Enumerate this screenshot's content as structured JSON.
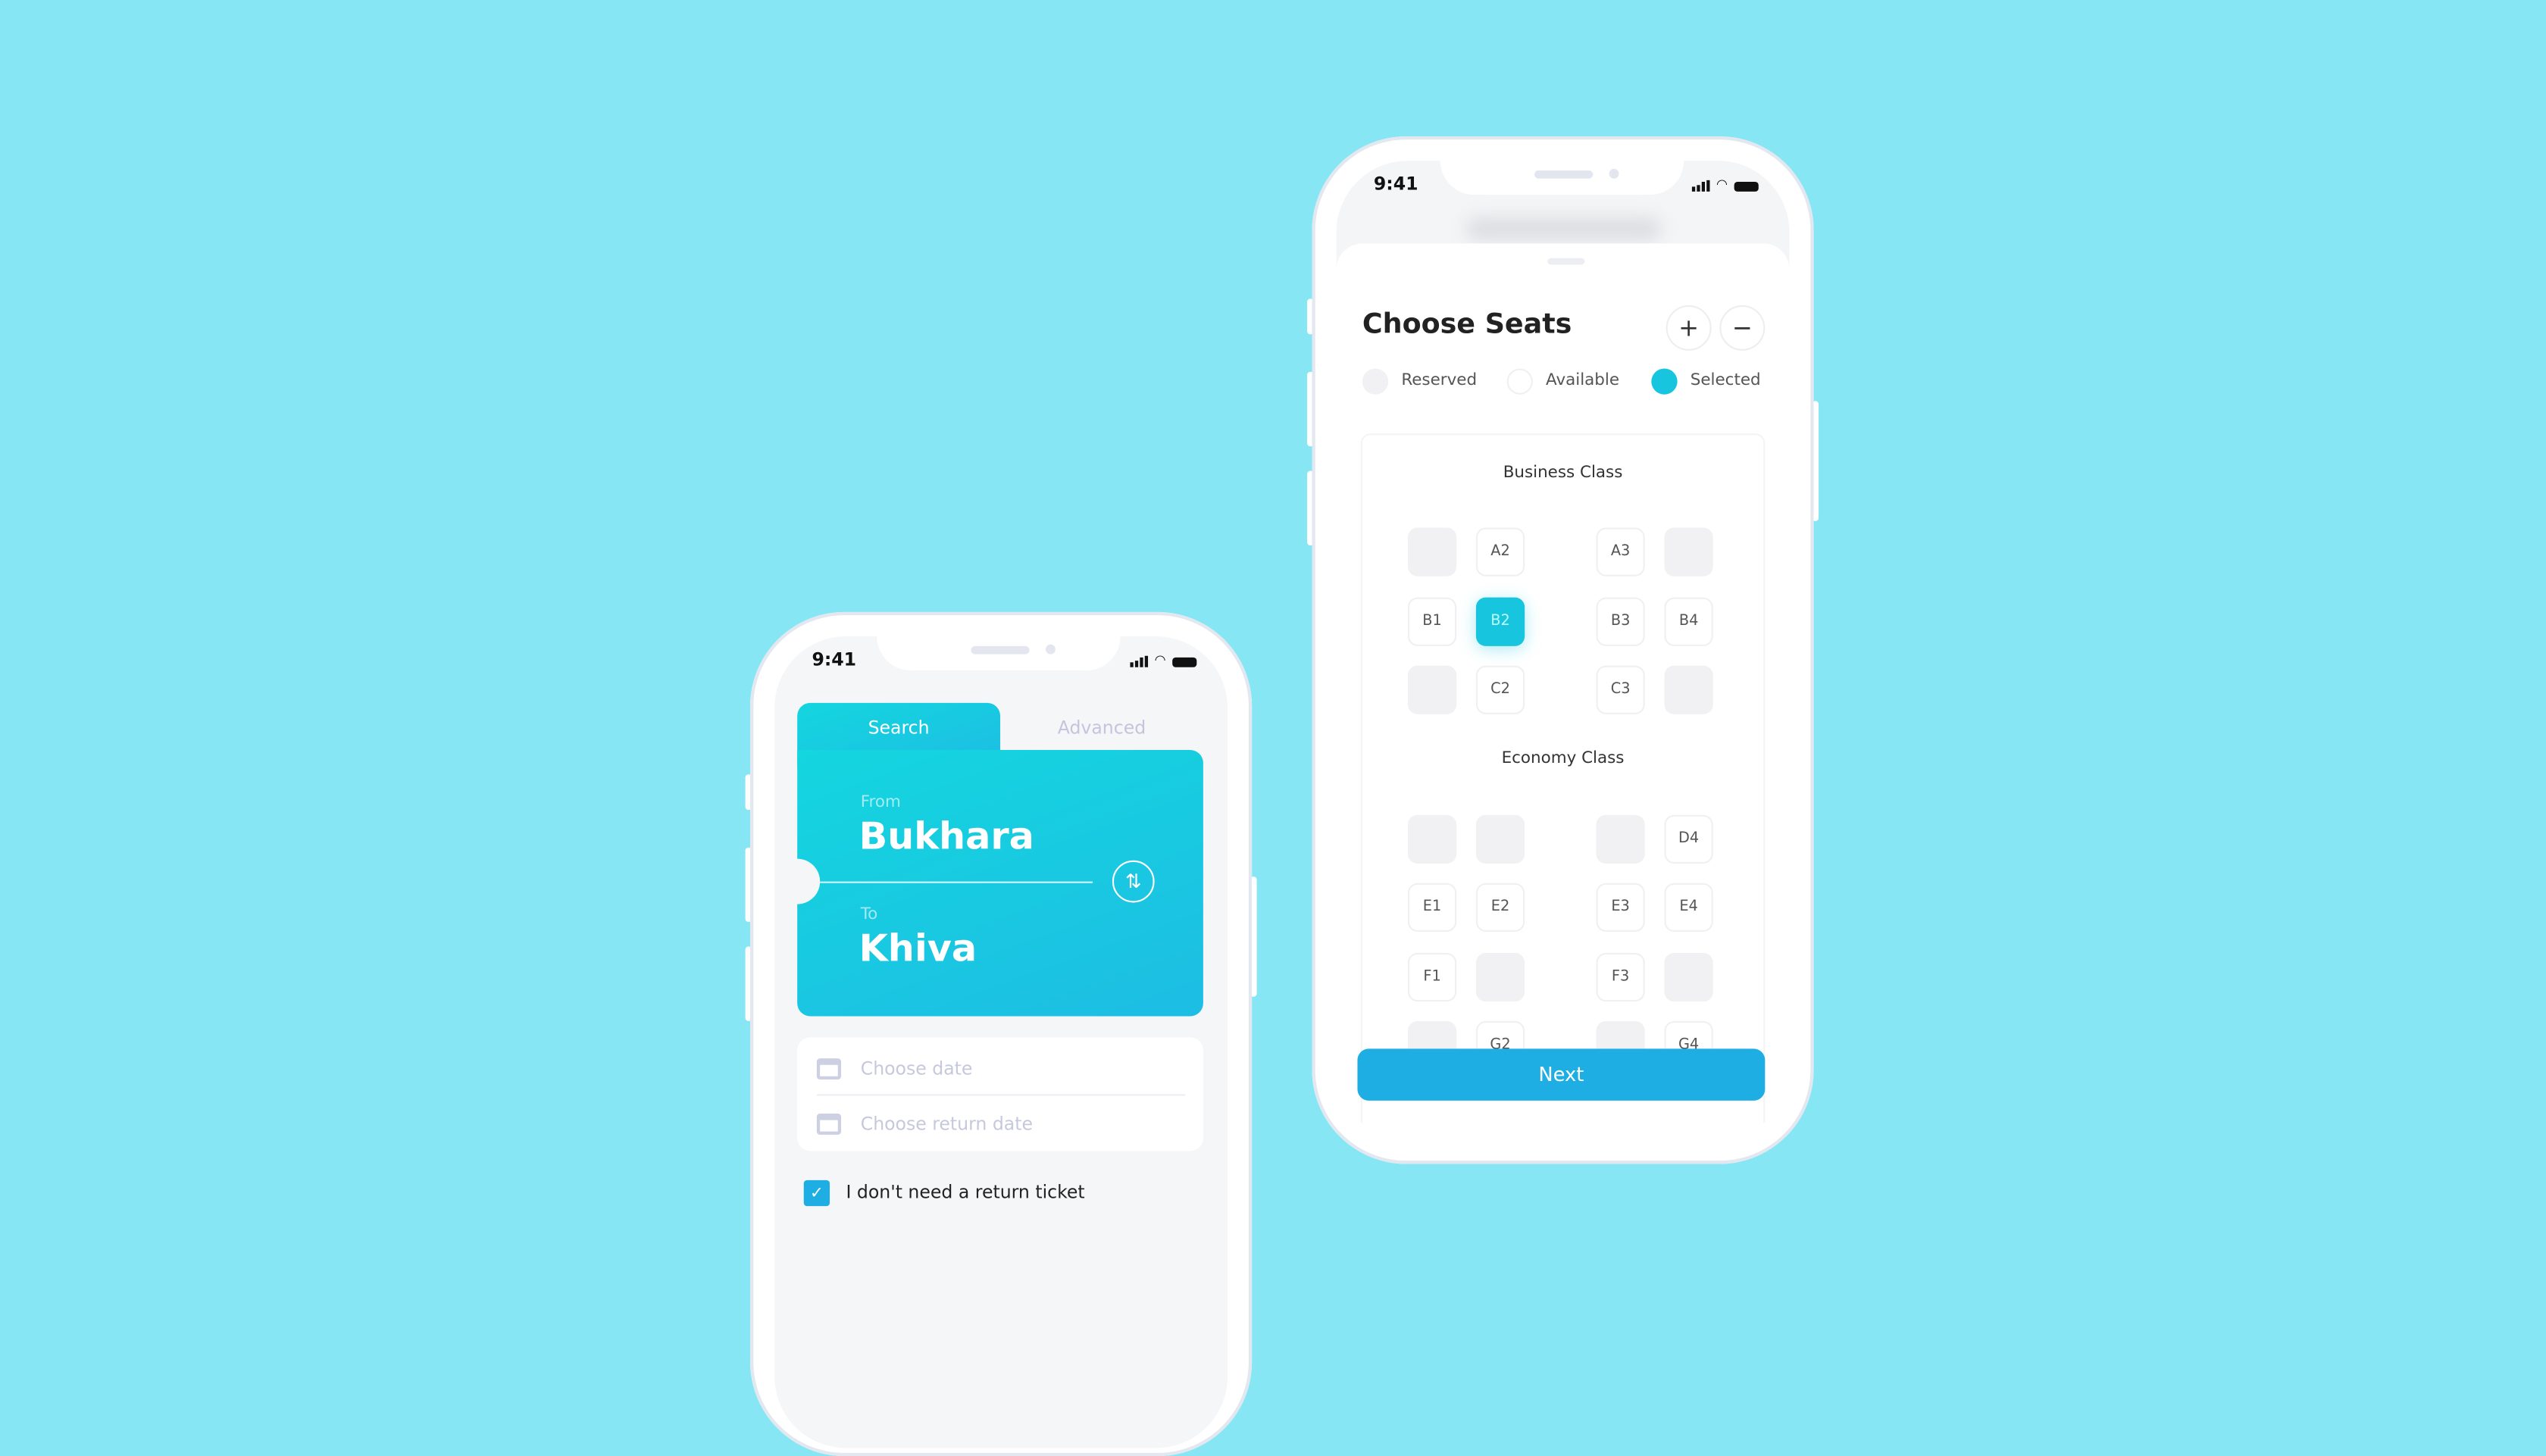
{
  "colors": {
    "background": "#86e6f3",
    "accent": "#17c6de",
    "button": "#1eaee3",
    "checkbox": "#1eaee3"
  },
  "search_phone": {
    "status": {
      "time": "9:41"
    },
    "tabs": [
      {
        "label": "Search",
        "active": true
      },
      {
        "label": "Advanced",
        "active": false
      }
    ],
    "from_label": "From",
    "from_city": "Bukhara",
    "to_label": "To",
    "to_city": "Khiva",
    "swap_icon": "swap-vertical-arrows-icon",
    "date_placeholder": "Choose date",
    "return_date_placeholder": "Choose return date",
    "no_return_checkbox": {
      "label": "I don't need a return ticket",
      "checked": true
    }
  },
  "seats_phone": {
    "status": {
      "time": "9:41"
    },
    "title": "Choose Seats",
    "zoom_in": "+",
    "zoom_out": "−",
    "legend": [
      {
        "label": "Reserved",
        "color": "#f1f1f3"
      },
      {
        "label": "Available",
        "color": "#ffffff"
      },
      {
        "label": "Selected",
        "color": "#17c6de"
      }
    ],
    "sections": [
      {
        "title": "Business Class",
        "rows": [
          [
            {
              "label": "",
              "state": "reserved"
            },
            {
              "label": "A2",
              "state": "available"
            },
            {
              "label": "A3",
              "state": "available"
            },
            {
              "label": "",
              "state": "reserved"
            }
          ],
          [
            {
              "label": "B1",
              "state": "available"
            },
            {
              "label": "B2",
              "state": "selected"
            },
            {
              "label": "B3",
              "state": "available"
            },
            {
              "label": "B4",
              "state": "available"
            }
          ],
          [
            {
              "label": "",
              "state": "reserved"
            },
            {
              "label": "C2",
              "state": "available"
            },
            {
              "label": "C3",
              "state": "available"
            },
            {
              "label": "",
              "state": "reserved"
            }
          ]
        ]
      },
      {
        "title": "Economy Class",
        "rows": [
          [
            {
              "label": "",
              "state": "reserved"
            },
            {
              "label": "",
              "state": "reserved"
            },
            {
              "label": "",
              "state": "reserved"
            },
            {
              "label": "D4",
              "state": "available"
            }
          ],
          [
            {
              "label": "E1",
              "state": "available"
            },
            {
              "label": "E2",
              "state": "available"
            },
            {
              "label": "E3",
              "state": "available"
            },
            {
              "label": "E4",
              "state": "available"
            }
          ],
          [
            {
              "label": "F1",
              "state": "available"
            },
            {
              "label": "",
              "state": "reserved"
            },
            {
              "label": "F3",
              "state": "available"
            },
            {
              "label": "",
              "state": "reserved"
            }
          ],
          [
            {
              "label": "",
              "state": "reserved"
            },
            {
              "label": "G2",
              "state": "available"
            },
            {
              "label": "",
              "state": "reserved"
            },
            {
              "label": "G4",
              "state": "available"
            }
          ]
        ]
      }
    ],
    "next_label": "Next"
  }
}
